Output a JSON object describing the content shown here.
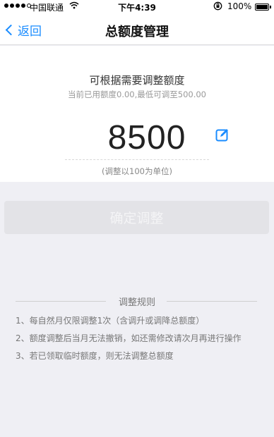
{
  "status_bar": {
    "carrier": "中国联通",
    "time": "下午4:39",
    "battery": "100%",
    "battery_level": 1.0,
    "signal_bars": 4,
    "signal_max": 5
  },
  "nav": {
    "back_label": "返回",
    "title": "总额度管理"
  },
  "adjust": {
    "heading": "可根据需要调整额度",
    "subtitle": "当前已用额度0.00,最低可调至500.00",
    "amount": "8500",
    "unit_hint": "(调整以100为单位)"
  },
  "confirm_button": "确定调整",
  "rules": {
    "title": "调整规则",
    "items": [
      "1、每自然月仅限调整1次（含调升或调降总额度）",
      "2、额度调整后当月无法撤销，如还需修改请次月再进行操作",
      "3、若已领取临时额度，则无法调整总额度"
    ]
  },
  "colors": {
    "accent": "#1a8cff",
    "background": "#efeff4"
  }
}
